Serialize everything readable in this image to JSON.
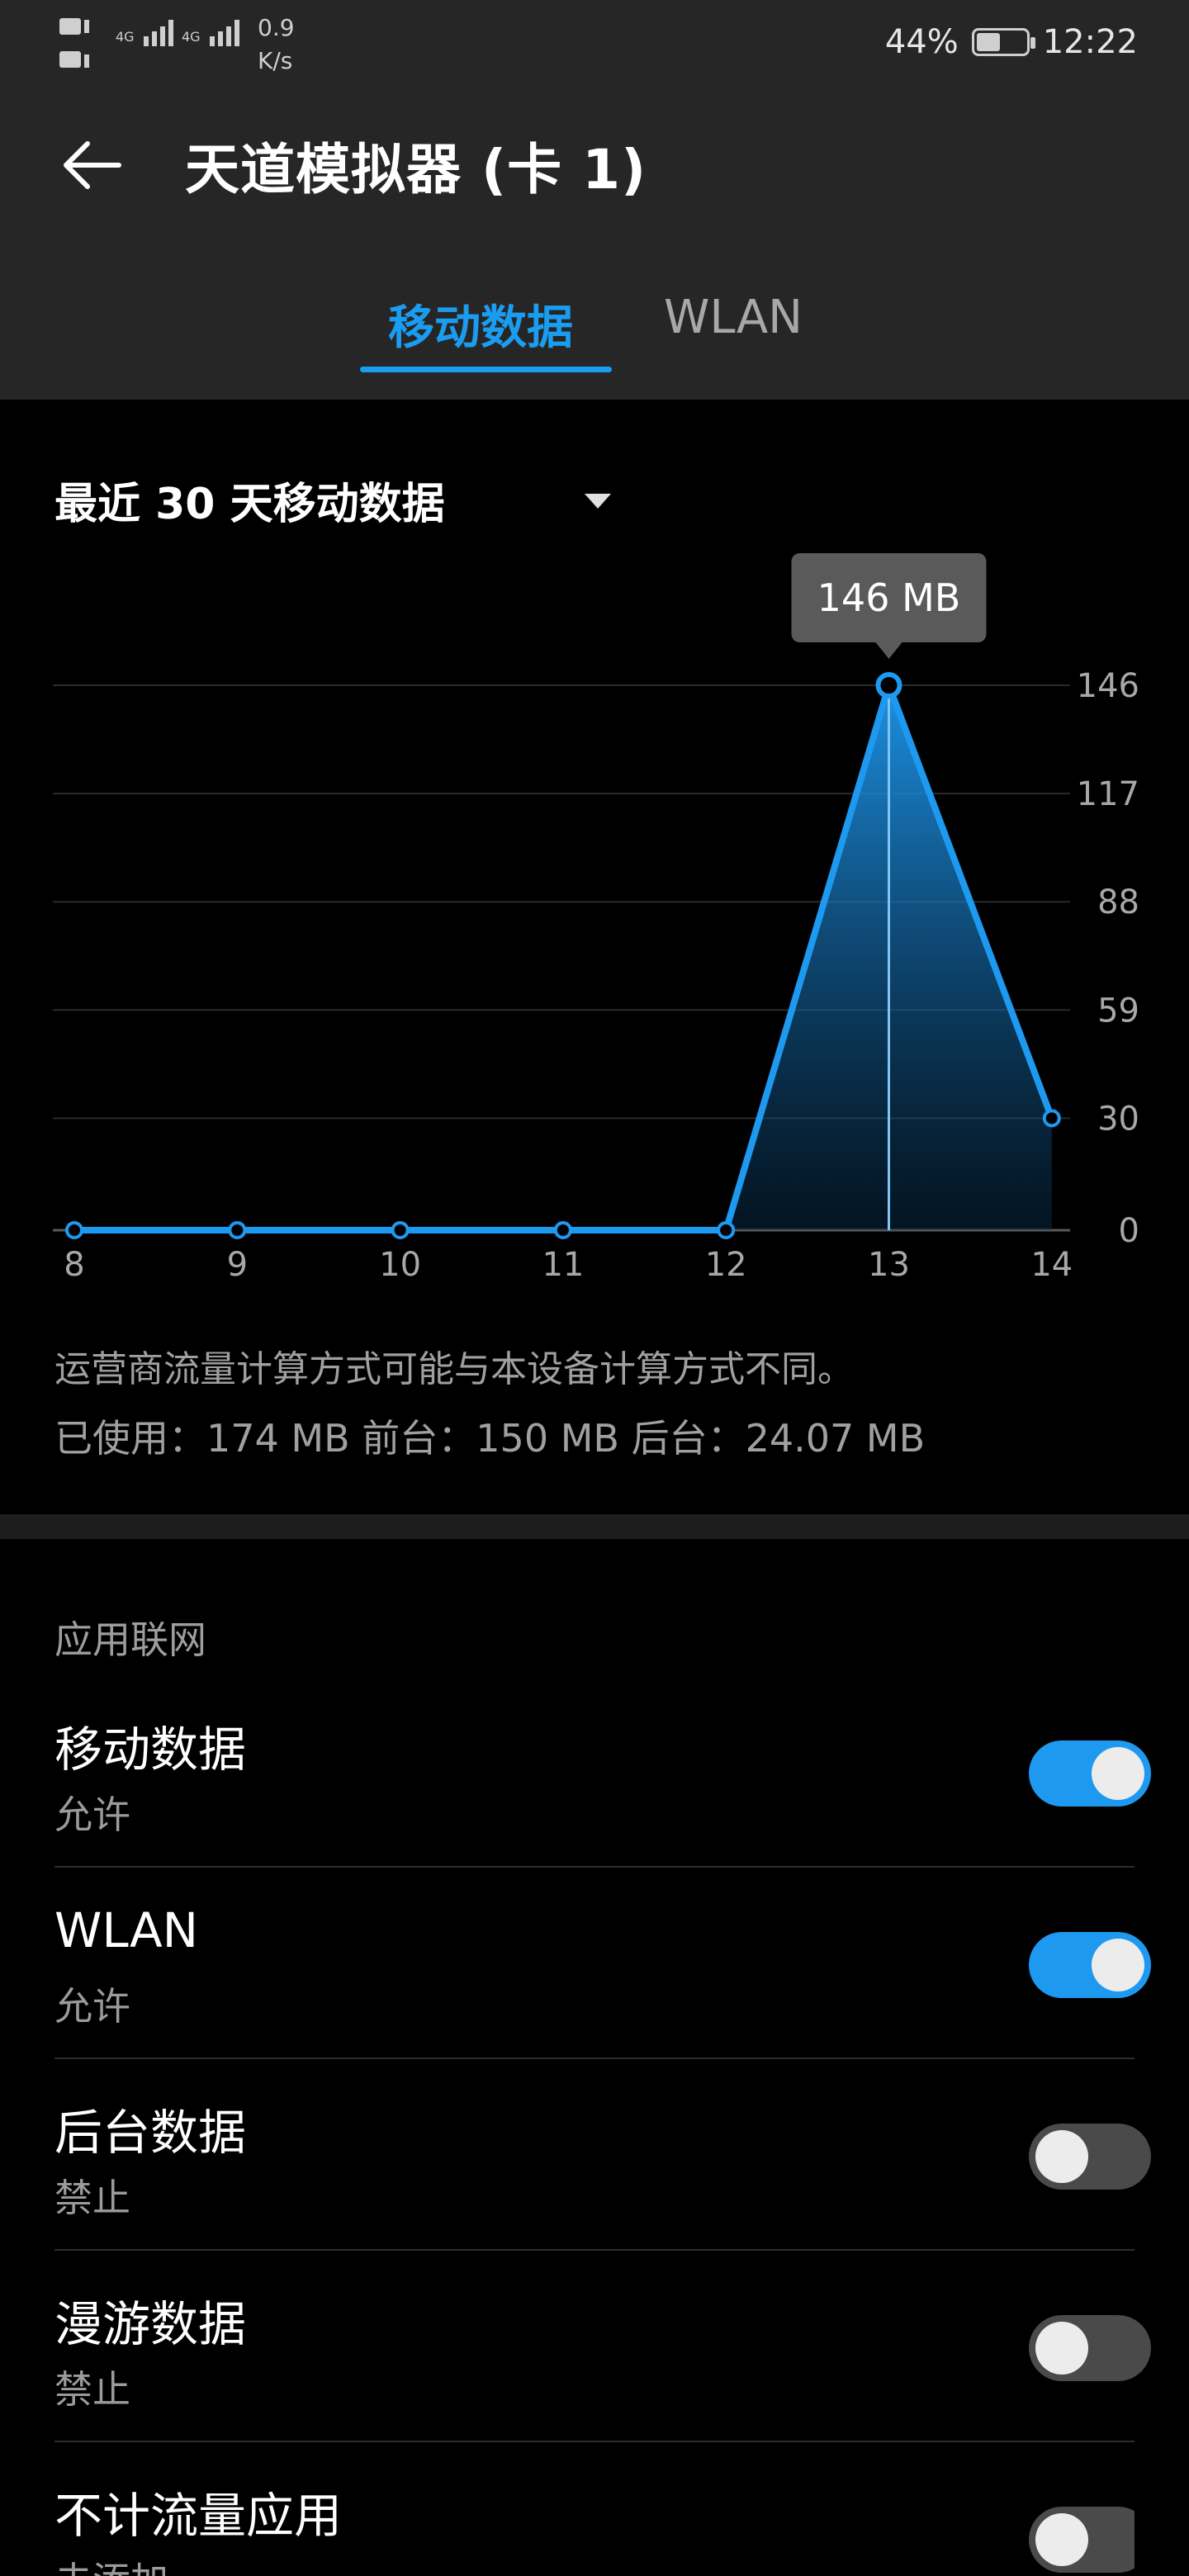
{
  "status_bar": {
    "net_speed_value": "0.9",
    "net_speed_unit": "K/s",
    "battery": "44%",
    "time": "12:22",
    "sim1_label": "HD",
    "sim2_label": "HD",
    "net_type": "4G"
  },
  "header": {
    "title": "天道模拟器 (卡 1)"
  },
  "tabs": [
    {
      "label": "移动数据",
      "active": true
    },
    {
      "label": "WLAN",
      "active": false
    }
  ],
  "period_selector": {
    "label": "最近 30 天移动数据"
  },
  "chart_data": {
    "type": "area",
    "x": [
      8,
      9,
      10,
      11,
      12,
      13,
      14
    ],
    "values": [
      0,
      0,
      0,
      0,
      0,
      146,
      30
    ],
    "x_tick_labels": [
      "8",
      "9",
      "10",
      "11",
      "12",
      "13",
      "14"
    ],
    "y_tick_labels": [
      "146",
      "117",
      "88",
      "59",
      "30",
      "0"
    ],
    "y_ticks": [
      146,
      117,
      88,
      59,
      30,
      0
    ],
    "ylim": [
      0,
      146
    ],
    "grid": true,
    "selected_index": 5,
    "tooltip": "146 MB",
    "line_color": "#1e99f0"
  },
  "note": "运营商流量计算方式可能与本设备计算方式不同。",
  "usage_summary": "已使用：174 MB 前台：150 MB 后台：24.07 MB",
  "app_network": {
    "section_label": "应用联网",
    "items": [
      {
        "title": "移动数据",
        "status": "允许",
        "enabled": true
      },
      {
        "title": "WLAN",
        "status": "允许",
        "enabled": true
      },
      {
        "title": "后台数据",
        "status": "禁止",
        "enabled": false
      },
      {
        "title": "漫游数据",
        "status": "禁止",
        "enabled": false
      },
      {
        "title": "不计流量应用",
        "status": "未添加",
        "enabled": false
      }
    ]
  },
  "colors": {
    "accent": "#1a9df0",
    "header_bg": "#262626",
    "toggle_off": "#4a4a4a"
  }
}
